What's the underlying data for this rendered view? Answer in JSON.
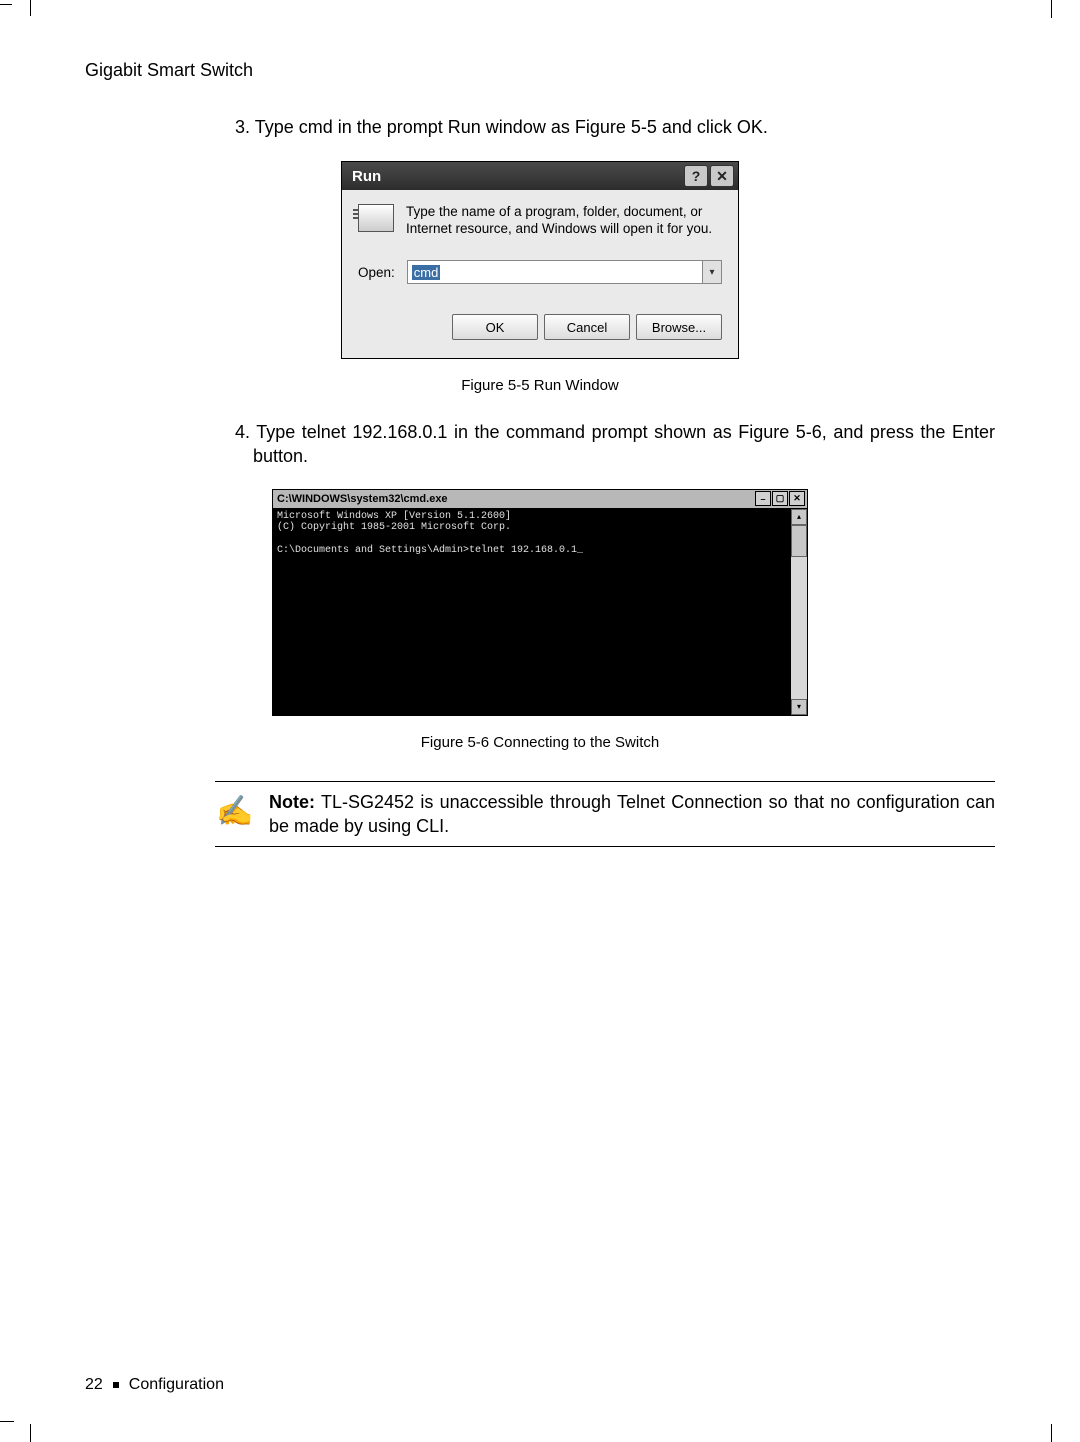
{
  "header": {
    "title": "Gigabit Smart Switch"
  },
  "step3": "3. Type cmd in the prompt Run window as Figure 5-5 and click OK.",
  "run_dialog": {
    "title": "Run",
    "help_btn": "?",
    "close_btn": "✕",
    "description": "Type the name of a program, folder, document, or Internet resource, and Windows will open it for you.",
    "open_label": "Open:",
    "open_value": "cmd",
    "dropdown_glyph": "▾",
    "ok_label": "OK",
    "cancel_label": "Cancel",
    "browse_label": "Browse..."
  },
  "figure5_caption": "Figure 5-5  Run Window",
  "step4": "4. Type telnet 192.168.0.1 in the command prompt shown as Figure 5-6, and press the Enter button.",
  "cmd_window": {
    "title_prefix": "  ",
    "title": "C:\\WINDOWS\\system32\\cmd.exe",
    "min_btn": "–",
    "max_btn": "▢",
    "close_btn": "✕",
    "up_btn": "▴",
    "down_btn": "▾",
    "line1": "Microsoft Windows XP [Version 5.1.2600]",
    "line2": "(C) Copyright 1985-2001 Microsoft Corp.",
    "line3": "",
    "line4": "C:\\Documents and Settings\\Admin>telnet 192.168.0.1_"
  },
  "figure6_caption": "Figure 5-6  Connecting to the Switch",
  "note": {
    "label": "Note:",
    "text": " TL-SG2452 is unaccessible through Telnet Connection so that no configuration can be made by using CLI."
  },
  "footer": {
    "page": "22",
    "section": "Configuration"
  }
}
